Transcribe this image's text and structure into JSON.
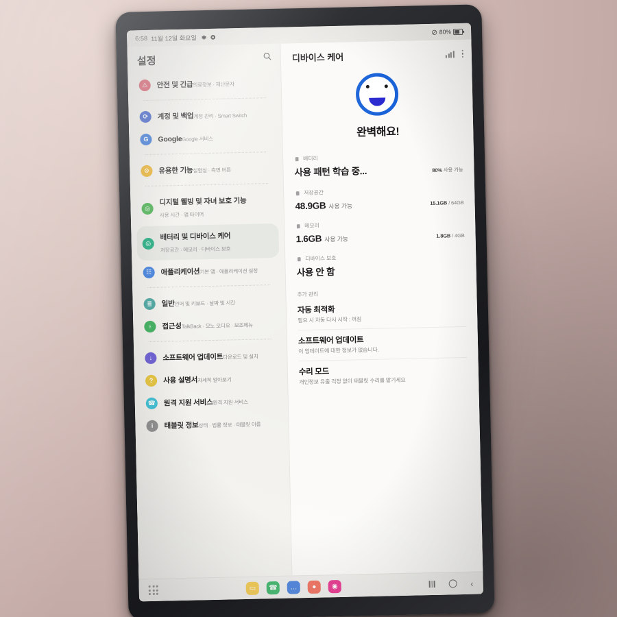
{
  "status_bar": {
    "time": "6:58",
    "date": "11월 12일 화요일",
    "icons": [
      "gear-icon",
      "record-icon"
    ],
    "mute_icon": "mute-icon",
    "battery_percent": "80%"
  },
  "sidebar": {
    "title": "설정",
    "search_icon": "search-icon",
    "items": [
      {
        "label": "안전 및 긴급",
        "sub": "의료정보 · 재난문자",
        "icon": "safety-icon",
        "color": "#d74b5e",
        "glyph": "⚠",
        "selected": false
      },
      {
        "label": "계정 및 백업",
        "sub": "계정 관리 · Smart Switch",
        "icon": "accounts-backup-icon",
        "color": "#2f55c9",
        "glyph": "⟳",
        "selected": false
      },
      {
        "label": "Google",
        "sub": "Google 서비스",
        "icon": "google-icon",
        "color": "#2f6fd8",
        "glyph": "G",
        "selected": false
      },
      {
        "label": "유용한 기능",
        "sub": "실험실 · 측면 버튼",
        "icon": "useful-features-icon",
        "color": "#edb021",
        "glyph": "⚙",
        "selected": false
      },
      {
        "label": "디지털 웰빙 및 자녀 보호 기능",
        "sub": "사용 시간 · 앱 타이머",
        "icon": "digital-wellbeing-icon",
        "color": "#43b04a",
        "glyph": "◎",
        "selected": false
      },
      {
        "label": "배터리 및 디바이스 케어",
        "sub": "저장공간 · 메모리 · 디바이스 보호",
        "icon": "device-care-icon",
        "color": "#17a97a",
        "glyph": "◎",
        "selected": true
      },
      {
        "label": "애플리케이션",
        "sub": "기본 앱 · 애플리케이션 설정",
        "icon": "applications-icon",
        "color": "#3c7ddd",
        "glyph": "☷",
        "selected": false
      },
      {
        "label": "일반",
        "sub": "언어 및 키보드 · 날짜 및 시간",
        "icon": "general-icon",
        "color": "#4aa5a0",
        "glyph": "≣",
        "selected": false
      },
      {
        "label": "접근성",
        "sub": "TalkBack · 모노 오디오 · 보조메뉴",
        "icon": "accessibility-icon",
        "color": "#3fb05e",
        "glyph": "♁",
        "selected": false
      },
      {
        "label": "소프트웨어 업데이트",
        "sub": "다운로드 및 설치",
        "icon": "software-update-icon",
        "color": "#6d5fd4",
        "glyph": "↓",
        "selected": false
      },
      {
        "label": "사용 설명서",
        "sub": "자세히 알아보기",
        "icon": "user-manual-icon",
        "color": "#e8c53c",
        "glyph": "?",
        "selected": false
      },
      {
        "label": "원격 지원 서비스",
        "sub": "원격 지원 서비스",
        "icon": "remote-support-icon",
        "color": "#3bbfd6",
        "glyph": "☎",
        "selected": false
      },
      {
        "label": "태블릿 정보",
        "sub": "상태 · 법률 정보 · 태블릿 이름",
        "icon": "tablet-info-icon",
        "color": "#8a8a8a",
        "glyph": "i",
        "selected": false
      }
    ],
    "dividers_after": [
      0,
      2,
      3,
      6,
      8
    ]
  },
  "detail": {
    "title": "디바이스 케어",
    "signal_icon": "signal-bars-icon",
    "menu_icon": "more-options-icon",
    "hero": {
      "face_icon": "smiley-face-icon",
      "status_text": "완벽해요!"
    },
    "status_rows": [
      {
        "label": "배터리",
        "icon": "battery-icon",
        "value": "사용 패턴 학습 중...",
        "value_sub": "",
        "meter_caption_strong": "80%",
        "meter_caption_rest": " 사용 가능",
        "fill_percent": 80,
        "fill_color": "#7fc88a"
      },
      {
        "label": "저장공간",
        "icon": "storage-icon",
        "value": "48.9GB",
        "value_sub": "사용 가능",
        "meter_caption_strong": "15.1GB",
        "meter_caption_rest": " / 64GB",
        "fill_percent": 24,
        "fill_color": "#45b97c"
      },
      {
        "label": "메모리",
        "icon": "memory-icon",
        "value": "1.6GB",
        "value_sub": "사용 가능",
        "meter_caption_strong": "1.8GB",
        "meter_caption_rest": " / 4GB",
        "fill_percent": 45,
        "fill_color": "#3a78d6"
      },
      {
        "label": "디바이스 보호",
        "icon": "shield-icon",
        "value": "사용 안 함",
        "value_sub": "",
        "meter_caption_strong": "",
        "meter_caption_rest": "",
        "fill_percent": 0,
        "fill_color": ""
      }
    ],
    "extra_section_title": "추가 관리",
    "extra_rows": [
      {
        "title": "자동 최적화",
        "sub": "필요 시 자동 다시 시작 : 꺼짐"
      },
      {
        "title": "소프트웨어 업데이트",
        "sub": "이 업데이트에 대한 정보가 없습니다."
      },
      {
        "title": "수리 모드",
        "sub": "개인정보 유출 걱정 없이 태블릿 수리를 맡기세요"
      }
    ]
  },
  "taskbar": {
    "apps_button_icon": "apps-grid-icon",
    "apps": [
      {
        "name": "my-files-app-icon",
        "color": "#f2c233",
        "glyph": "▭"
      },
      {
        "name": "phone-app-icon",
        "color": "#1fab52",
        "glyph": "☎"
      },
      {
        "name": "messages-app-icon",
        "color": "#2f6fd8",
        "glyph": "…"
      },
      {
        "name": "contacts-app-icon",
        "color": "#ef5a46",
        "glyph": "●"
      },
      {
        "name": "camera-app-icon",
        "color": "#e5197f",
        "glyph": "◉"
      }
    ],
    "nav": {
      "recents_icon": "recents-button",
      "home_icon": "home-button",
      "back_icon": "back-button"
    }
  }
}
